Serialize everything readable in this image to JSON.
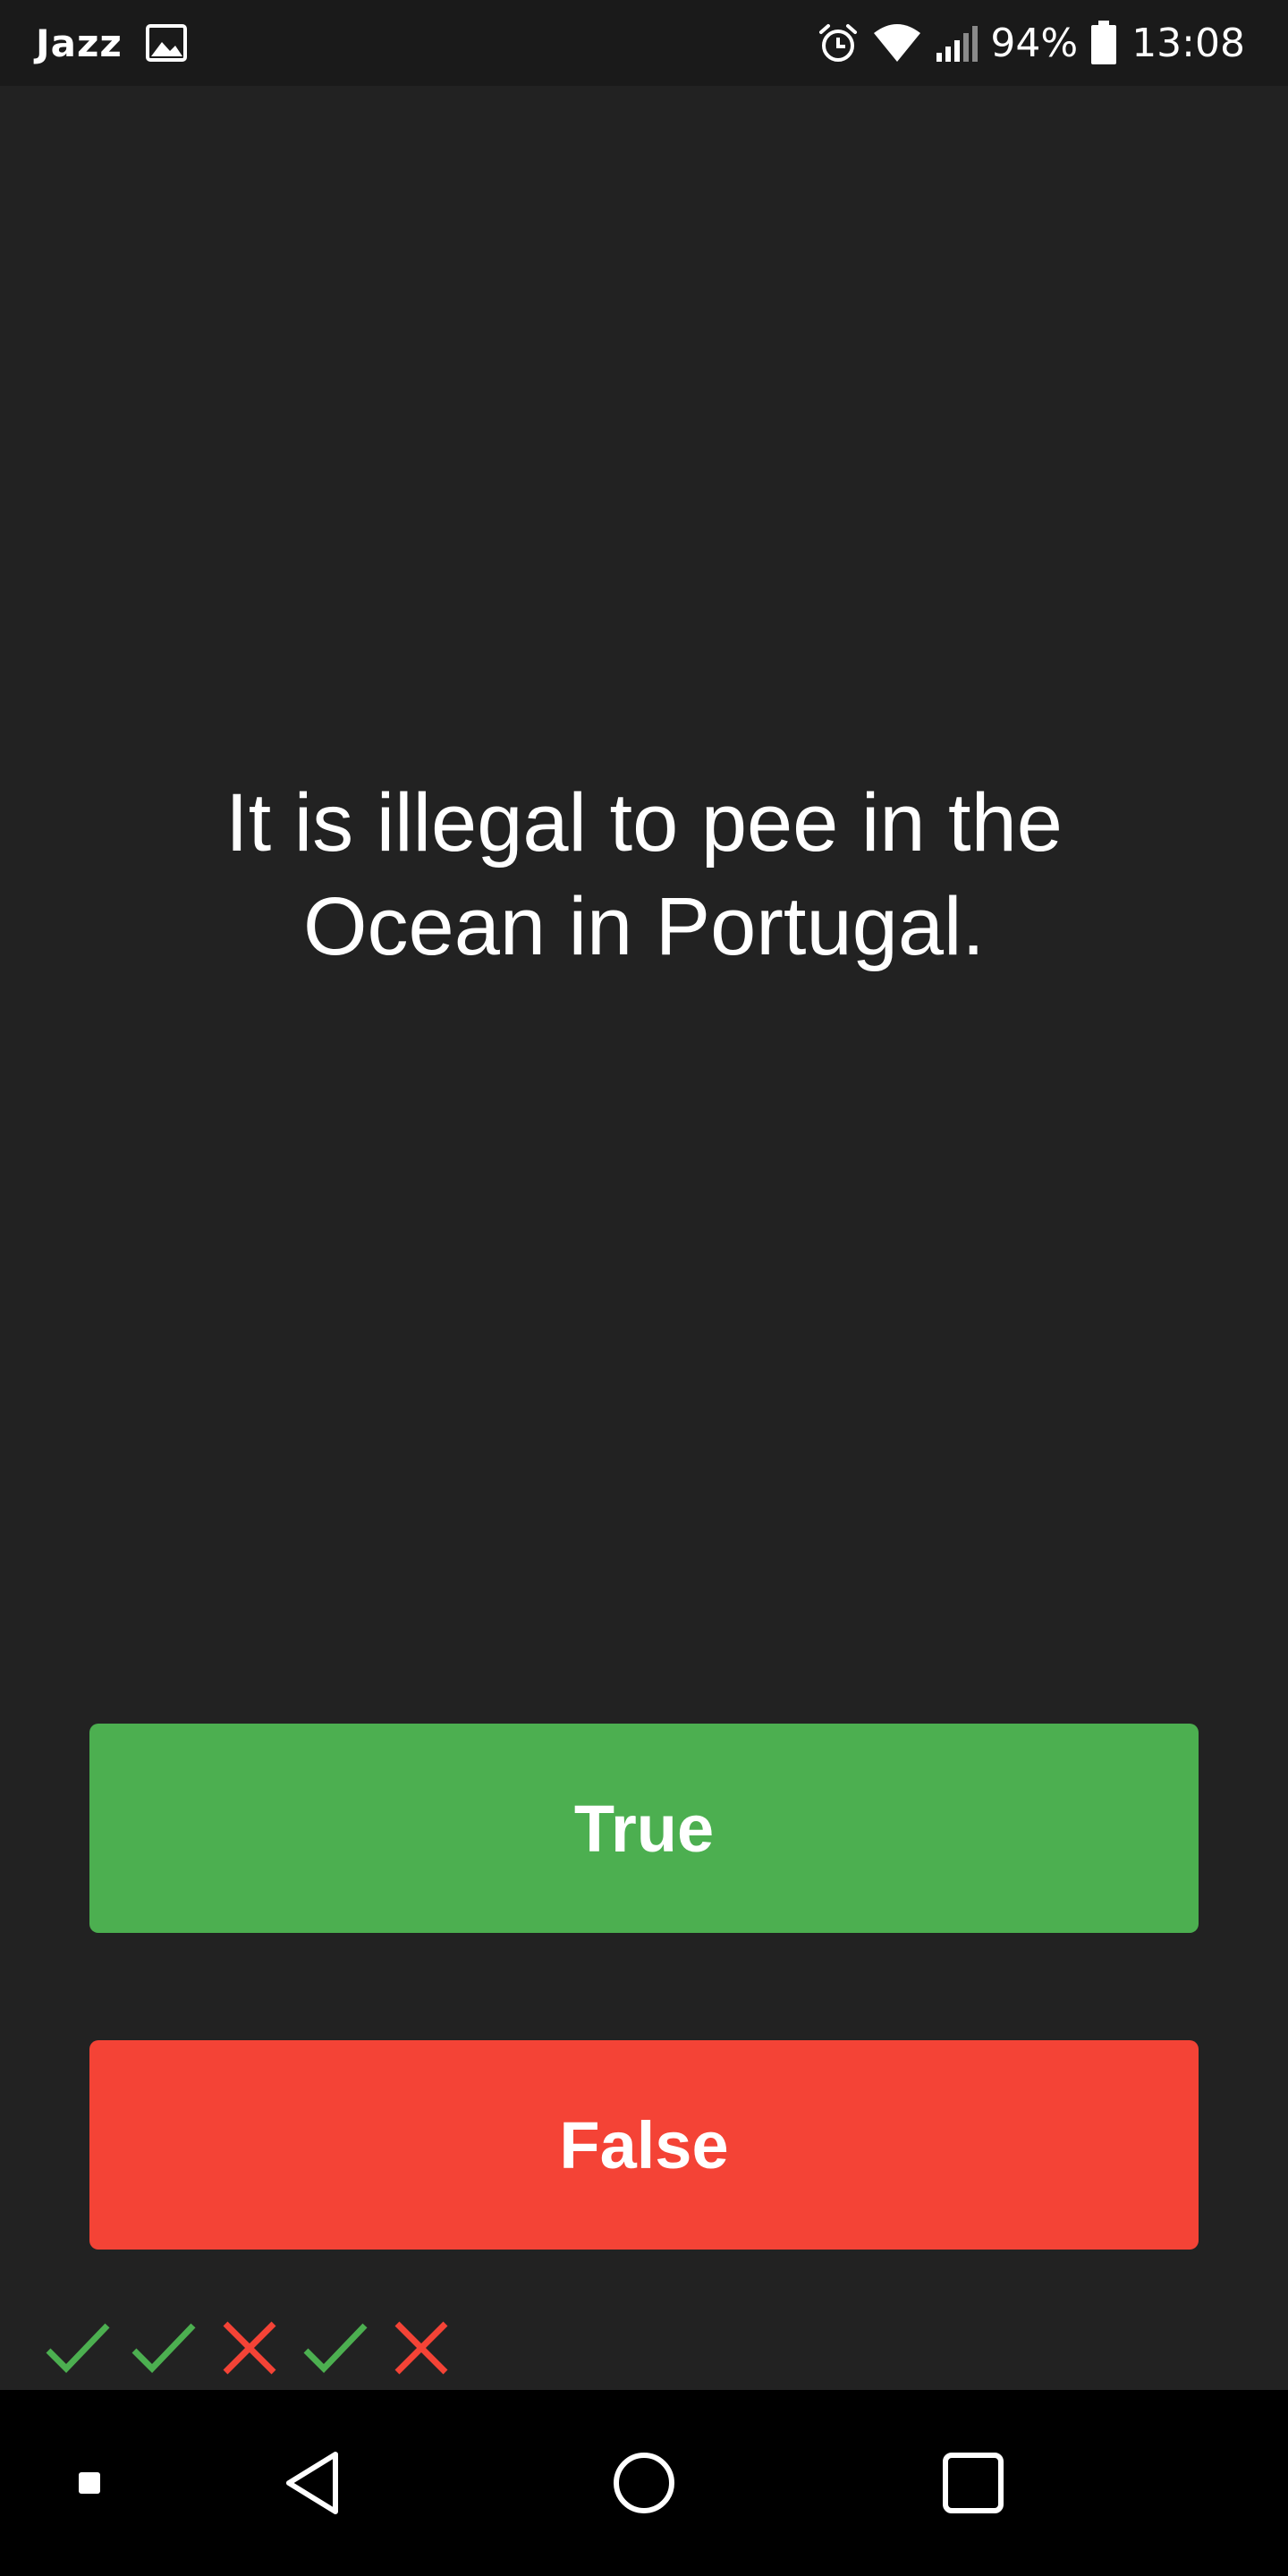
{
  "status_bar": {
    "carrier": "Jazz",
    "battery_percent": "94%",
    "time": "13:08",
    "icons": [
      "image-icon",
      "alarm-icon",
      "wifi-icon",
      "signal-icon",
      "battery-icon"
    ]
  },
  "quiz": {
    "question": "It is illegal to pee in the Ocean in Portugal.",
    "true_label": "True",
    "false_label": "False",
    "history": [
      "correct",
      "correct",
      "wrong",
      "correct",
      "wrong"
    ]
  },
  "nav_bar": {
    "icons": [
      "dot-icon",
      "back-icon",
      "home-icon",
      "recents-icon"
    ]
  },
  "colors": {
    "background": "#222222",
    "true": "#4caf50",
    "false": "#f44336",
    "correct_mark": "#4caf50",
    "wrong_mark": "#f44336"
  }
}
